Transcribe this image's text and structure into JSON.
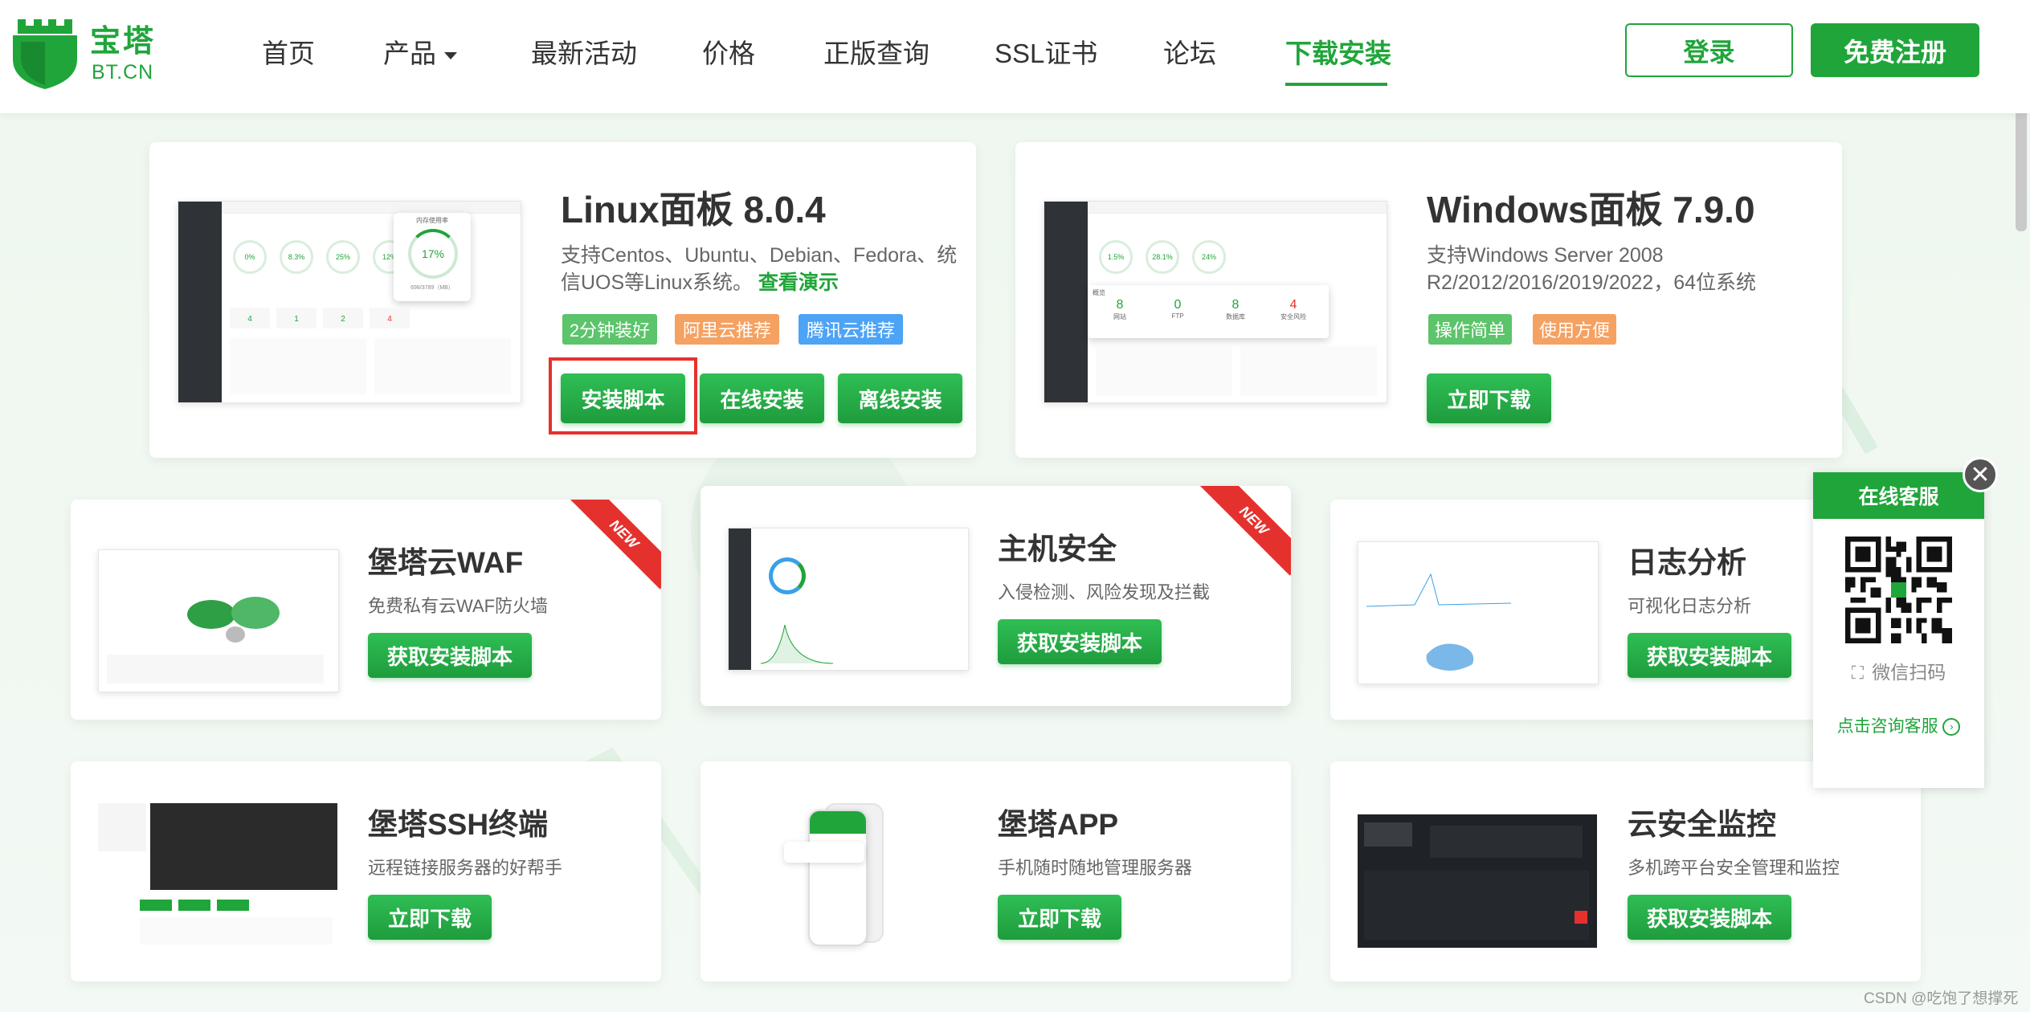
{
  "header": {
    "logo_cn": "宝塔",
    "logo_en": "BT.CN",
    "nav": [
      "首页",
      "产品",
      "最新活动",
      "价格",
      "正版查询",
      "SSL证书",
      "论坛",
      "下载安装"
    ],
    "login": "登录",
    "register": "免费注册"
  },
  "linux": {
    "title": "Linux面板 8.0.4",
    "desc": "支持Centos、Ubuntu、Debian、Fedora、统信UOS等Linux系统。",
    "demo_link": "查看演示",
    "tags": [
      "2分钟装好",
      "阿里云推荐",
      "腾讯云推荐"
    ],
    "buttons": [
      "安装脚本",
      "在线安装",
      "离线安装"
    ],
    "mock": {
      "gauges": [
        "0%",
        "8.3%",
        "25%",
        "12%"
      ],
      "big_gauge": "17%",
      "big_gauge_label": "内存使用率",
      "big_gauge_sub": "698/3789（MB）",
      "counts": [
        "4",
        "1",
        "2",
        "4"
      ]
    }
  },
  "windows": {
    "title": "Windows面板 7.9.0",
    "desc": "支持Windows Server 2008 R2/2012/2016/2019/2022，64位系统",
    "tags": [
      "操作简单",
      "使用方便"
    ],
    "button": "立即下载",
    "mock": {
      "gauges": [
        "1.5%",
        "28.1%",
        "24%"
      ],
      "overview_label": "概览",
      "stats": [
        {
          "value": "8",
          "label": "网站"
        },
        {
          "value": "0",
          "label": "FTP"
        },
        {
          "value": "8",
          "label": "数据库"
        },
        {
          "value": "4",
          "label": "安全风险"
        }
      ]
    }
  },
  "products": [
    {
      "title": "堡塔云WAF",
      "desc": "免费私有云WAF防火墙",
      "button": "获取安装脚本",
      "badge": "NEW"
    },
    {
      "title": "主机安全",
      "desc": "入侵检测、风险发现及拦截",
      "button": "获取安装脚本",
      "badge": "NEW"
    },
    {
      "title": "日志分析",
      "desc": "可视化日志分析",
      "button": "获取安装脚本"
    },
    {
      "title": "堡塔SSH终端",
      "desc": "远程链接服务器的好帮手",
      "button": "立即下载"
    },
    {
      "title": "堡塔APP",
      "desc": "手机随时随地管理服务器",
      "button": "立即下载"
    },
    {
      "title": "云安全监控",
      "desc": "多机跨平台安全管理和监控",
      "button": "获取安装脚本"
    }
  ],
  "service": {
    "title": "在线客服",
    "scan": "微信扫码",
    "link": "点击咨询客服",
    "close": "✕"
  },
  "watermark": "CSDN @吃饱了想撑死",
  "colors": {
    "brand": "#20a53a",
    "tag_green": "#5cc46a",
    "tag_orange": "#f5a161",
    "tag_blue": "#4da3f5",
    "new_red": "#e5312e"
  }
}
